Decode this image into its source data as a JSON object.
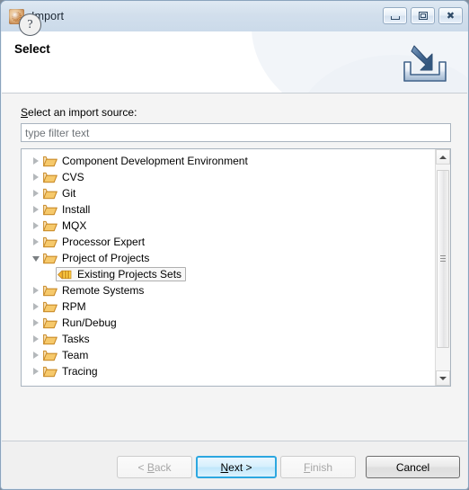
{
  "window": {
    "title": "Import",
    "app_icon": "import-wizard-icon",
    "controls": {
      "minimize": "minimize-icon",
      "restore": "restore-icon",
      "close": "close-icon"
    }
  },
  "header": {
    "title": "Select",
    "banner_icon": "import-arrow-into-tray-icon"
  },
  "form": {
    "source_label_prefix": "S",
    "source_label_rest": "elect an import source:",
    "filter_placeholder": "type filter text",
    "filter_value": ""
  },
  "tree": {
    "items": [
      {
        "label": "Component Development Environment",
        "icon": "folder-icon",
        "state": "collapsed",
        "level": 0,
        "selected": false
      },
      {
        "label": "CVS",
        "icon": "folder-icon",
        "state": "collapsed",
        "level": 0,
        "selected": false
      },
      {
        "label": "Git",
        "icon": "folder-icon",
        "state": "collapsed",
        "level": 0,
        "selected": false
      },
      {
        "label": "Install",
        "icon": "folder-icon",
        "state": "collapsed",
        "level": 0,
        "selected": false
      },
      {
        "label": "MQX",
        "icon": "folder-icon",
        "state": "collapsed",
        "level": 0,
        "selected": false
      },
      {
        "label": "Processor Expert",
        "icon": "folder-icon",
        "state": "collapsed",
        "level": 0,
        "selected": false
      },
      {
        "label": "Project of Projects",
        "icon": "folder-icon",
        "state": "expanded",
        "level": 0,
        "selected": false
      },
      {
        "label": "Existing Projects Sets",
        "icon": "project-set-icon",
        "state": "leaf",
        "level": 1,
        "selected": true
      },
      {
        "label": "Remote Systems",
        "icon": "folder-icon",
        "state": "collapsed",
        "level": 0,
        "selected": false
      },
      {
        "label": "RPM",
        "icon": "folder-icon",
        "state": "collapsed",
        "level": 0,
        "selected": false
      },
      {
        "label": "Run/Debug",
        "icon": "folder-icon",
        "state": "collapsed",
        "level": 0,
        "selected": false
      },
      {
        "label": "Tasks",
        "icon": "folder-icon",
        "state": "collapsed",
        "level": 0,
        "selected": false
      },
      {
        "label": "Team",
        "icon": "folder-icon",
        "state": "collapsed",
        "level": 0,
        "selected": false
      },
      {
        "label": "Tracing",
        "icon": "folder-icon",
        "state": "collapsed",
        "level": 0,
        "selected": false
      }
    ],
    "scrollbar": {
      "up_icon": "scroll-up-arrow-icon",
      "down_icon": "scroll-down-arrow-icon"
    }
  },
  "footer": {
    "help_label": "?",
    "buttons": [
      {
        "key": "back",
        "label": "< Back",
        "mnemonic": "B",
        "state": "disabled"
      },
      {
        "key": "next",
        "label": "Next >",
        "mnemonic": "N",
        "state": "default"
      },
      {
        "key": "finish",
        "label": "Finish",
        "mnemonic": "F",
        "state": "disabled"
      },
      {
        "key": "cancel",
        "label": "Cancel",
        "mnemonic": "",
        "state": "enabled"
      }
    ]
  },
  "colors": {
    "title_bar": "#d2dfec",
    "dialog_bg": "#f4f4f4",
    "header_bg": "#ffffff",
    "folder": "#e8a33d",
    "accent_default_button": "#2ca7e0",
    "text": "#000000",
    "placeholder": "#6f7479"
  }
}
